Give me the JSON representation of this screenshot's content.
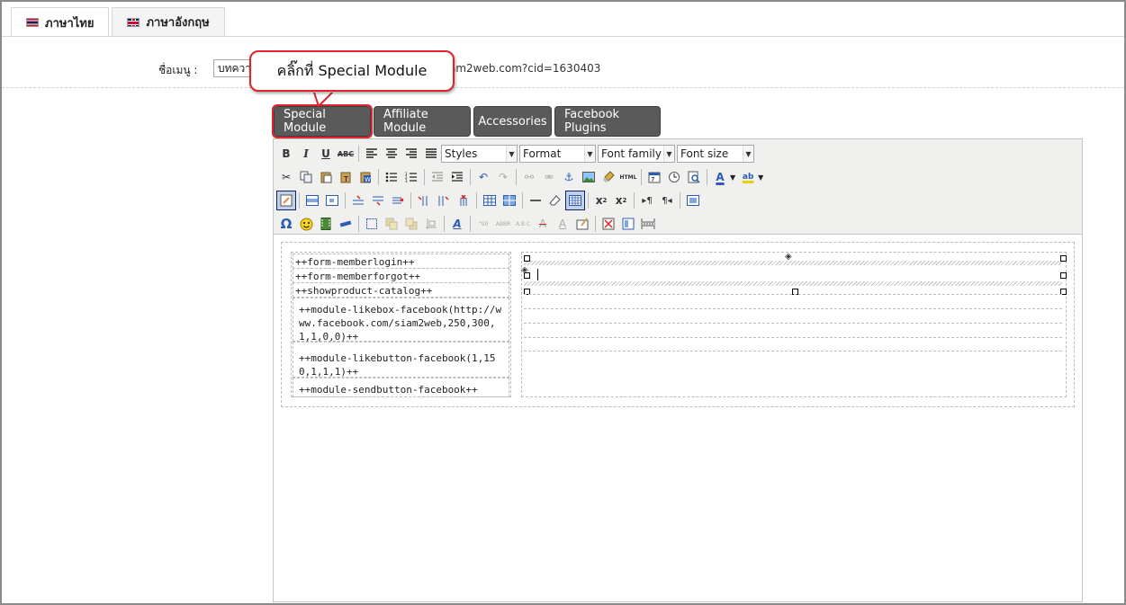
{
  "tabs": [
    {
      "label": "ภาษาไทย",
      "flag": "thai-flag-icon",
      "active": true
    },
    {
      "label": "ภาษาอังกฤษ",
      "flag": "uk-flag-icon",
      "active": false
    }
  ],
  "menu": {
    "label": "ชื่อเมนู :",
    "value": "บทความ",
    "url": "am2web.com?cid=1630403"
  },
  "callout": {
    "text": "คลิ๊กที่ Special Module"
  },
  "module_buttons": [
    {
      "label": "Special Module",
      "highlighted": true
    },
    {
      "label": "Affiliate Module",
      "highlighted": false
    },
    {
      "label": "Accessories",
      "highlighted": false
    },
    {
      "label": "Facebook Plugins",
      "highlighted": false
    }
  ],
  "toolbar": {
    "styles": "Styles",
    "format": "Format",
    "font_family": "Font family",
    "font_size": "Font size",
    "bold": "B",
    "italic": "I",
    "underline": "U",
    "strike": "ABC",
    "html": "HTML",
    "omega": "Ω"
  },
  "modules": [
    "++form-memberlogin++",
    "++form-memberforgot++",
    "++showproduct-catalog++",
    "++module-likebox-facebook(http://www.facebook.com/siam2web,250,300,1,1,0,0)++",
    "++module-likebutton-facebook(1,150,1,1,1)++",
    "++module-sendbutton-facebook++"
  ],
  "colors": {
    "accent_red": "#e0242b",
    "button_gray": "#5a5a5a",
    "toolbar_bg": "#f0f0ee"
  }
}
